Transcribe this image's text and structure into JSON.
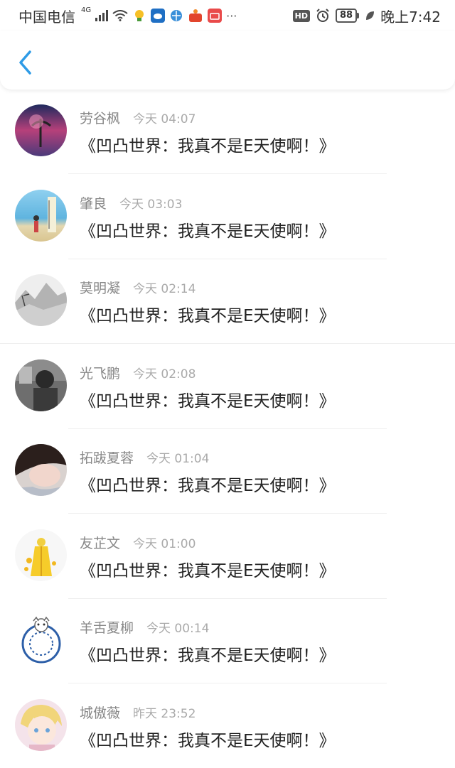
{
  "status_bar": {
    "carrier": "中国电信",
    "network": "4G",
    "hd": "HD",
    "battery": "88",
    "time": "晚上7:42",
    "more": "···"
  },
  "nav": {
    "back_icon": "chevron-left-icon"
  },
  "comments": [
    {
      "username": "劳谷枫",
      "time": "今天 04:07",
      "text": "《凹凸世界：我真不是E天使啊！》"
    },
    {
      "username": "肇良",
      "time": "今天 03:03",
      "text": "《凹凸世界：我真不是E天使啊！》"
    },
    {
      "username": "莫明凝",
      "time": "今天 02:14",
      "text": "《凹凸世界：我真不是E天使啊！》"
    },
    {
      "username": "光飞鹏",
      "time": "今天 02:08",
      "text": "《凹凸世界：我真不是E天使啊！》"
    },
    {
      "username": "拓跋夏蓉",
      "time": "今天 01:04",
      "text": "《凹凸世界：我真不是E天使啊！》"
    },
    {
      "username": "友芷文",
      "time": "今天 01:00",
      "text": "《凹凸世界：我真不是E天使啊！》"
    },
    {
      "username": "羊舌夏柳",
      "time": "今天 00:14",
      "text": "《凹凸世界：我真不是E天使啊！》"
    },
    {
      "username": "城傲薇",
      "time": "昨天 23:52",
      "text": "《凹凸世界：我真不是E天使啊！》"
    }
  ],
  "colors": {
    "accent": "#2e9be6",
    "username": "#888888",
    "timestamp": "#aaaaaa"
  }
}
